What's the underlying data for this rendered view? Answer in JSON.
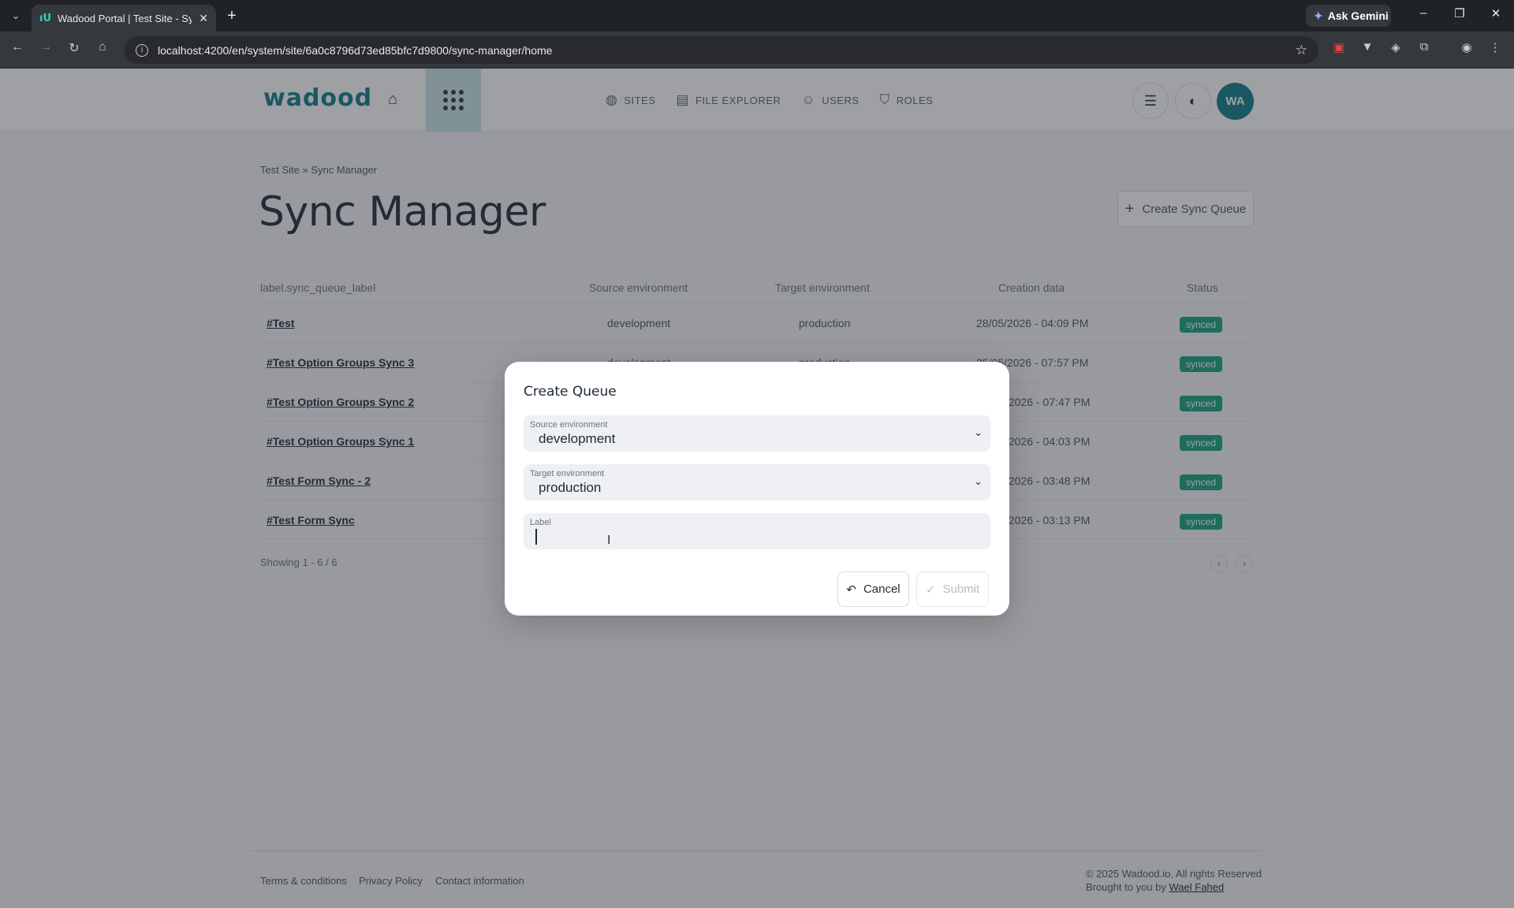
{
  "browser": {
    "tab_title": "Wadood Portal | Test Site - Sync",
    "url": "localhost:4200/en/system/site/6a0c8796d73ed85bfc7d9800/sync-manager/home",
    "gemini_label": "Ask Gemini"
  },
  "header": {
    "logo": "wadood",
    "nav": [
      {
        "label": "SITES",
        "icon": "globe-icon"
      },
      {
        "label": "FILE EXPLORER",
        "icon": "folder-images-icon"
      },
      {
        "label": "USERS",
        "icon": "users-icon"
      },
      {
        "label": "ROLES",
        "icon": "shield-icon"
      }
    ],
    "avatar_initials": "WA"
  },
  "breadcrumb": {
    "site": "Test Site",
    "current": " » Sync Manager"
  },
  "page_title": "Sync Manager",
  "create_button_label": "Create Sync Queue",
  "table": {
    "headers": [
      "label.sync_queue_label",
      "Source environment",
      "Target environment",
      "Creation data",
      "Status"
    ],
    "rows": [
      {
        "label": "#Test",
        "source": "development",
        "target": "production",
        "created": "28/05/2026 - 04:09 PM",
        "status": "synced"
      },
      {
        "label": "#Test Option Groups Sync 3",
        "source": "development",
        "target": "production",
        "created": "25/05/2026 - 07:57 PM",
        "status": "synced"
      },
      {
        "label": "#Test Option Groups Sync 2",
        "source": "",
        "target": "",
        "created": "/2026 - 07:47 PM",
        "status": "synced"
      },
      {
        "label": "#Test Option Groups Sync 1",
        "source": "",
        "target": "",
        "created": "/2026 - 04:03 PM",
        "status": "synced"
      },
      {
        "label": "#Test Form Sync - 2",
        "source": "",
        "target": "",
        "created": "/2026 - 03:48 PM",
        "status": "synced"
      },
      {
        "label": "#Test Form Sync",
        "source": "",
        "target": "",
        "created": "/2026 - 03:13 PM",
        "status": "synced"
      }
    ],
    "showing": "Showing 1 - 6 / 6"
  },
  "footer": {
    "links": [
      "Terms & conditions",
      "Privacy Policy",
      "Contact information"
    ],
    "copyright": "© 2025 Wadood.io, All rights Reserved",
    "brought_by": "Brought to you by ",
    "author": "Wael Fahed"
  },
  "modal": {
    "title": "Create Queue",
    "source_caption": "Source environment",
    "source_value": "development",
    "target_caption": "Target environment",
    "target_value": "production",
    "label_caption": "Label",
    "label_value": "",
    "cancel": "Cancel",
    "submit": "Submit"
  },
  "colors": {
    "brand": "#0f7c8a",
    "synced_badge": "#16a37f"
  }
}
